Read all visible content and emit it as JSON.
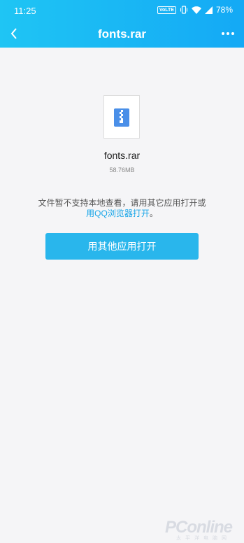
{
  "status_bar": {
    "time": "11:25",
    "volte": "VoLTE",
    "battery": "78%"
  },
  "nav": {
    "title": "fonts.rar",
    "back_icon": "chevron-left-icon",
    "more_icon": "more-icon"
  },
  "file": {
    "name": "fonts.rar",
    "size": "58.76MB",
    "icon": "zip-file-icon"
  },
  "notice": {
    "line1": "文件暂不支持本地查看，请用其它应用打开或",
    "link": "用QQ浏览器打开",
    "line2_suffix": "。"
  },
  "actions": {
    "open_label": "用其他应用打开"
  },
  "watermark": {
    "brand": "PConline",
    "sub": "太平洋电脑网"
  },
  "colors": {
    "accent": "#1fb8f4",
    "button": "#29b6ec",
    "link": "#1aa6e8",
    "background": "#f5f5f7"
  }
}
